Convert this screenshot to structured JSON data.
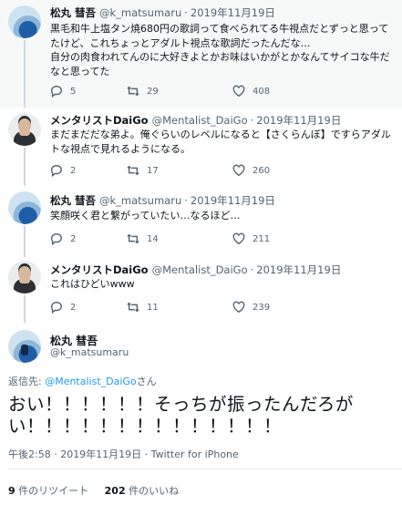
{
  "tweets": [
    {
      "name": "松丸 彗吾",
      "handle": "@k_matsumaru",
      "date": "2019年11月19日",
      "text": "黒毛和牛上塩タン焼680円の歌詞って食べられてる牛視点だとずっと思ってたけど、これちょっとアダルト視点な歌詞だったんだな…\n自分の肉食われてんのに大好きよとかお味はいかがとかなんてサイコな牛だなと思ってた",
      "replies": "5",
      "retweets": "29",
      "likes": "408"
    },
    {
      "name": "メンタリストDaiGo",
      "handle": "@Mentalist_DaiGo",
      "date": "2019年11月19日",
      "text": "まだまだだな弟よ。俺ぐらいのレベルになると【さくらんぼ】ですらアダルトな視点で見れるようになる。",
      "replies": "2",
      "retweets": "17",
      "likes": "260"
    },
    {
      "name": "松丸 彗吾",
      "handle": "@k_matsumaru",
      "date": "2019年11月19日",
      "text": "笑顔咲く君と繋がっていたい…なるほど…",
      "replies": "2",
      "retweets": "14",
      "likes": "211"
    },
    {
      "name": "メンタリストDaiGo",
      "handle": "@Mentalist_DaiGo",
      "date": "2019年11月19日",
      "text": "これはひどいwww",
      "replies": "2",
      "retweets": "11",
      "likes": "239"
    }
  ],
  "main": {
    "name": "松丸 彗吾",
    "handle": "@k_matsumaru",
    "reply_prefix": "返信先: ",
    "reply_mention": "@Mentalist_DaiGo",
    "reply_suffix": "さん",
    "text": "おい！！！！！！そっちが振ったんだろがい！！！！！！！！！！！！！！",
    "meta": "午後2:58 · 2019年11月19日 · Twitter for iPhone",
    "retweet_count": "9",
    "retweet_label": " 件のリツイート",
    "like_count": "202",
    "like_label": " 件のいいね"
  },
  "icons": [
    "reply-icon",
    "retweet-icon",
    "like-icon"
  ],
  "colors": {
    "link": "#1d9bf0",
    "muted": "#536471",
    "text": "#0f1419",
    "highlight_bg": "#f7f9f9"
  }
}
